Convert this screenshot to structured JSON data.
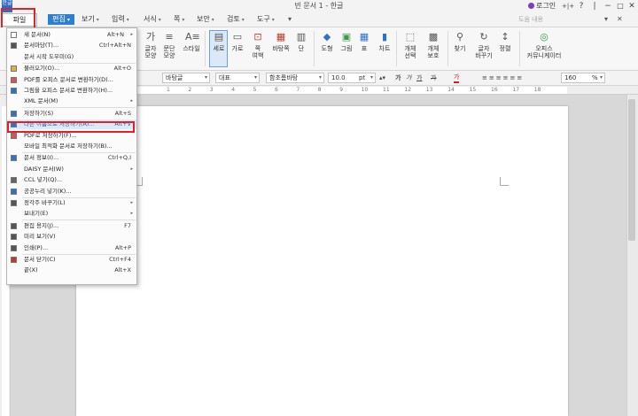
{
  "window": {
    "title": "빈 문서 1 - 한글",
    "app_logo": "한글",
    "login_label": "로그인",
    "login_color": "#7b3fb8",
    "help_symbol": "?",
    "pin_symbol": "+|+"
  },
  "menubar": {
    "file": "파일",
    "edit": "편집",
    "items": [
      "보기",
      "입력",
      "서식",
      "쪽",
      "보안",
      "검토",
      "도구"
    ],
    "help_placeholder": "도움 내용",
    "accent": "#2f7fd1",
    "highlight_color": "#e0212a"
  },
  "ribbon": {
    "buttons": [
      {
        "label": "글자\n모양",
        "icon": "char-shape-icon"
      },
      {
        "label": "문단\n모양",
        "icon": "paragraph-shape-icon"
      },
      {
        "label": "스타일",
        "icon": "style-icon"
      },
      {
        "label": "세로",
        "icon": "vertical-view-icon"
      },
      {
        "label": "가로",
        "icon": "horizontal-view-icon"
      },
      {
        "label": "쪽\n여백",
        "icon": "page-margin-icon"
      },
      {
        "label": "바탕쪽",
        "icon": "master-page-icon"
      },
      {
        "label": "단",
        "icon": "columns-icon"
      },
      {
        "label": "도형",
        "icon": "shape-icon"
      },
      {
        "label": "그림",
        "icon": "image-icon"
      },
      {
        "label": "표",
        "icon": "table-icon"
      },
      {
        "label": "차트",
        "icon": "chart-icon"
      },
      {
        "label": "개체\n선택",
        "icon": "select-object-icon"
      },
      {
        "label": "개체\n보호",
        "icon": "protect-object-icon"
      },
      {
        "label": "찾기",
        "icon": "find-icon"
      },
      {
        "label": "글자\n바꾸기",
        "icon": "replace-icon"
      },
      {
        "label": "정렬",
        "icon": "sort-icon"
      },
      {
        "label": "오피스\n커뮤니케이터",
        "icon": "office-communicator-icon"
      }
    ]
  },
  "format_toolbar": {
    "style": "바탕글",
    "lang": "대표",
    "font": "함초롬바탕",
    "size": "10.0",
    "unit": "pt",
    "zoom": "160",
    "zoom_unit": "%",
    "bold": "가",
    "italic": "가",
    "underline": "가",
    "strike": "가",
    "color_text": "가"
  },
  "ruler": {
    "ticks": [
      "1",
      "2",
      "3",
      "4",
      "5",
      "6",
      "7",
      "8",
      "9",
      "10",
      "11",
      "12",
      "13",
      "14",
      "15",
      "16",
      "17",
      "18"
    ]
  },
  "file_menu": {
    "items": [
      {
        "label": "새 문서(N)",
        "shortcut": "Alt+N",
        "arrow": true,
        "icon": "new-doc-icon"
      },
      {
        "label": "문서마당(T)...",
        "shortcut": "Ctrl+Alt+N",
        "arrow": false,
        "icon": "template-icon"
      },
      {
        "label": "문서 시작 도우미(G)",
        "shortcut": "",
        "arrow": false,
        "icon": ""
      },
      {
        "label": "불러오기(O)...",
        "shortcut": "Alt+O",
        "arrow": false,
        "icon": "open-folder-icon"
      },
      {
        "label": "PDF를 오피스 문서로 변환하기(D)...",
        "shortcut": "",
        "arrow": false,
        "icon": "pdf-convert-icon"
      },
      {
        "label": "그림을 오피스 문서로 변환하기(H)...",
        "shortcut": "",
        "arrow": false,
        "icon": "image-convert-icon"
      },
      {
        "label": "XML 문서(M)",
        "shortcut": "",
        "arrow": true,
        "icon": ""
      },
      {
        "label": "저장하기(S)",
        "shortcut": "Alt+S",
        "arrow": false,
        "icon": "save-icon"
      },
      {
        "label": "다른 이름으로 저장하기(A)...",
        "shortcut": "Alt+V",
        "arrow": false,
        "icon": "save-as-icon"
      },
      {
        "label": "PDF로 저장하기(F)...",
        "shortcut": "",
        "arrow": false,
        "icon": "pdf-save-icon"
      },
      {
        "label": "모바일 최적화 문서로 저장하기(B)...",
        "shortcut": "",
        "arrow": false,
        "icon": ""
      },
      {
        "label": "문서 정보(I)...",
        "shortcut": "Ctrl+Q,I",
        "arrow": false,
        "icon": "doc-info-icon"
      },
      {
        "label": "DAISY 문서(W)",
        "shortcut": "",
        "arrow": true,
        "icon": ""
      },
      {
        "label": "CCL 넣기(Q)...",
        "shortcut": "",
        "arrow": false,
        "icon": "ccl-icon"
      },
      {
        "label": "공공누리 넣기(K)...",
        "shortcut": "",
        "arrow": false,
        "icon": "kogl-icon"
      },
      {
        "label": "정각주 바꾸기(L)",
        "shortcut": "",
        "arrow": true,
        "icon": "footnote-icon"
      },
      {
        "label": "보내기(E)",
        "shortcut": "",
        "arrow": true,
        "icon": ""
      },
      {
        "label": "편집 용지(J)...",
        "shortcut": "F7",
        "arrow": false,
        "icon": "paper-setup-icon"
      },
      {
        "label": "미리 보기(V)",
        "shortcut": "",
        "arrow": false,
        "icon": "preview-icon"
      },
      {
        "label": "인쇄(P)...",
        "shortcut": "Alt+P",
        "arrow": false,
        "icon": "print-icon"
      },
      {
        "label": "문서 닫기(C)",
        "shortcut": "Ctrl+F4",
        "arrow": false,
        "icon": "close-doc-icon"
      },
      {
        "label": "끝(X)",
        "shortcut": "Alt+X",
        "arrow": false,
        "icon": ""
      }
    ]
  }
}
